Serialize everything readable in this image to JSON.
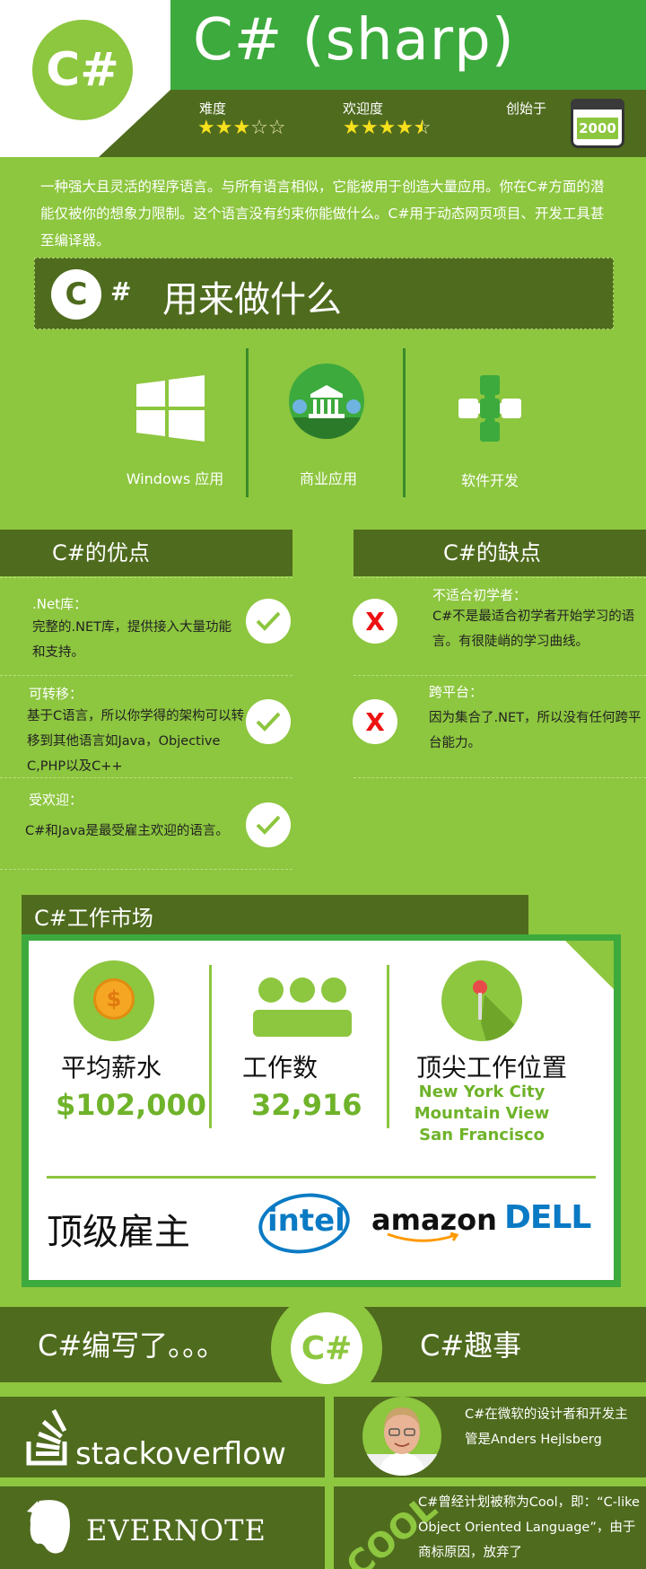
{
  "header": {
    "logo": "C#",
    "title": "C# (sharp)",
    "difficulty_label": "难度",
    "difficulty_stars": 3,
    "popularity_label": "欢迎度",
    "popularity_stars": 4.5,
    "founded_label": "创始于",
    "founded_year": "2000"
  },
  "intro": "一种强大且灵活的程序语言。与所有语言相似，它能被用于创造大量应用。你在C#方面的潜能仅被你的想象力限制。这个语言没有约束你能做什么。C#用于动态网页项目、开发工具甚至编译器。",
  "uses": {
    "title_logo": "C#",
    "title": "用来做什么",
    "items": [
      {
        "icon": "windows-logo-icon",
        "label": "Windows 应用"
      },
      {
        "icon": "bank-building-icon",
        "label": "商业应用"
      },
      {
        "icon": "puzzle-pieces-icon",
        "label": "软件开发"
      }
    ]
  },
  "pros": {
    "title": "C#的优点",
    "items": [
      {
        "title": ".Net库：",
        "text": "完整的.NET库，提供接入大量功能和支持。"
      },
      {
        "title": "可转移：",
        "text": "基于C语言，所以你学得的架构可以转移到其他语言如Java，Objective C,PHP以及C++"
      },
      {
        "title": "受欢迎：",
        "text": "C#和Java是最受雇主欢迎的语言。"
      }
    ]
  },
  "cons": {
    "title": "C#的缺点",
    "mark": "X",
    "items": [
      {
        "title": "不适合初学者：",
        "text": "C#不是最适合初学者开始学习的语言。有很陡峭的学习曲线。"
      },
      {
        "title": "跨平台：",
        "text": "因为集合了.NET，所以没有任何跨平台能力。"
      }
    ]
  },
  "jobs": {
    "title": "C#工作市场",
    "salary_label": "平均薪水",
    "salary_value": "$102,000",
    "count_label": "工作数",
    "count_value": "32,916",
    "locations_label": "顶尖工作位置",
    "locations": [
      "New York City",
      "Mountain View",
      "San Francisco"
    ],
    "employers_label": "顶级雇主",
    "employers": [
      "intel",
      "amazon",
      "DELL"
    ]
  },
  "bottom": {
    "written_title": "C#编写了。。。",
    "logo": "C#",
    "fun_title": "C#趣事",
    "written": [
      "stackoverflow",
      "EVERNOTE"
    ],
    "fun": [
      "C#在微软的设计者和开发主管是Anders Hejlsberg",
      "C#曾经计划被称为Cool，即：“C-like Object Oriented Language”，由于商标原因，放弃了"
    ],
    "cool_word": "COOL"
  },
  "colors": {
    "bg": "#8dc63f",
    "dark": "#4f6b1e",
    "green": "#3daa3d",
    "star": "#f7e01d"
  }
}
